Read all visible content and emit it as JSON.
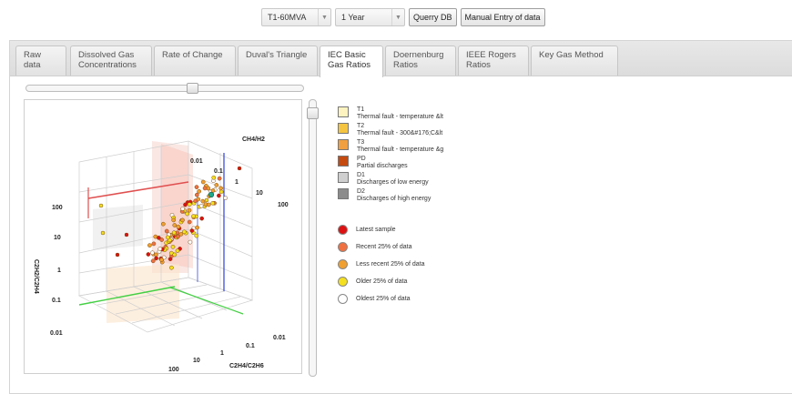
{
  "toolbar": {
    "transformer": "T1-60MVA",
    "period": "1 Year",
    "query_button": "Querry DB",
    "manual_button": "Manual Entry of data"
  },
  "tabs": [
    {
      "line1": "Raw data",
      "line2": ""
    },
    {
      "line1": "Dissolved Gas",
      "line2": "Concentrations"
    },
    {
      "line1": "Rate of Change",
      "line2": ""
    },
    {
      "line1": "Duval's Triangle",
      "line2": ""
    },
    {
      "line1": "IEC Basic",
      "line2": "Gas Ratios"
    },
    {
      "line1": "Doernenburg",
      "line2": "Ratios"
    },
    {
      "line1": "IEEE Rogers",
      "line2": "Ratios"
    },
    {
      "line1": "Key Gas Method",
      "line2": ""
    }
  ],
  "active_tab_index": 4,
  "plot": {
    "axis_ch4_h2": "CH4/H2",
    "axis_c2h2_c2h4": "C2H2/C2H4",
    "axis_c2h4_c2h6": "C2H4/C2H6",
    "ch4_ticks": [
      "0.01",
      "0.1",
      "1",
      "10",
      "100"
    ],
    "c2h2_ticks": [
      "100",
      "10",
      "1",
      "0.1",
      "0.01"
    ],
    "c2h4_ticks": [
      "100",
      "10",
      "1",
      "0.1",
      "0.01"
    ]
  },
  "legend_zones": [
    {
      "code": "T1",
      "desc": "Thermal fault - temperature &lt",
      "color": "#fdf3c0"
    },
    {
      "code": "T2",
      "desc": "Thermal fault - 300&#176;C&lt",
      "color": "#f5c542"
    },
    {
      "code": "T3",
      "desc": "Thermal fault - temperature &g",
      "color": "#f0a040"
    },
    {
      "code": "PD",
      "desc": "Partial discharges",
      "color": "#c44a10"
    },
    {
      "code": "D1",
      "desc": "Discharges of low energy",
      "color": "#cfcfcf"
    },
    {
      "code": "D2",
      "desc": "Discharges of high energy",
      "color": "#8c8c8c"
    }
  ],
  "legend_samples": [
    {
      "label": "Latest sample",
      "color": "#dd1111"
    },
    {
      "label": "Recent 25% of data",
      "color": "#f07040"
    },
    {
      "label": "Less recent 25% of data",
      "color": "#f0a030"
    },
    {
      "label": "Older 25% of data",
      "color": "#f5e020"
    },
    {
      "label": "Oldest 25% of data",
      "color": "#ffffff"
    }
  ]
}
